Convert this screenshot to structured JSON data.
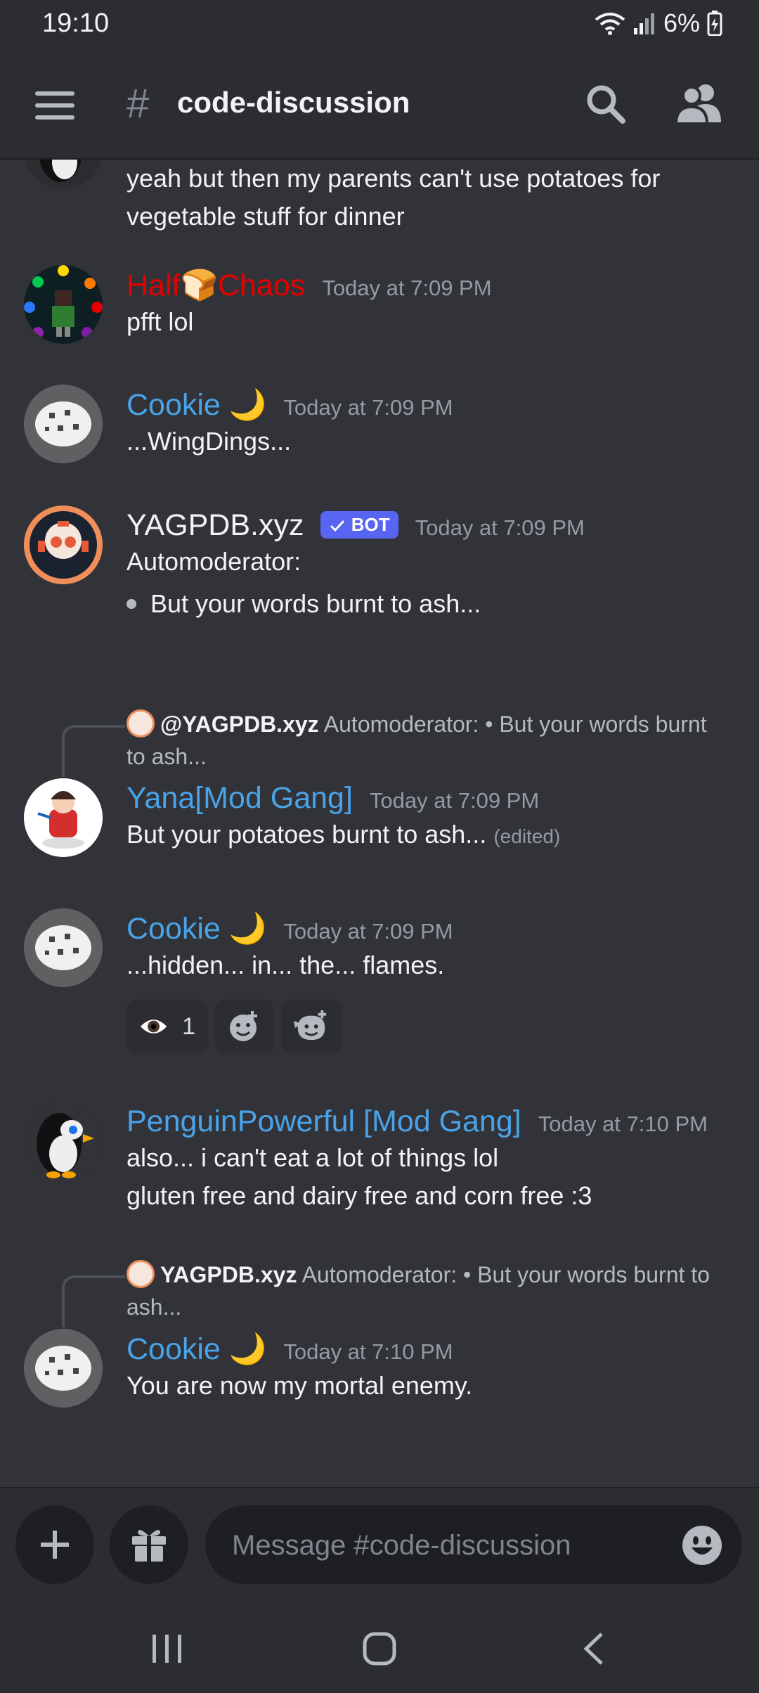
{
  "status_bar": {
    "time": "19:10",
    "battery": "6%"
  },
  "header": {
    "channel_name": "code-discussion"
  },
  "messages": {
    "partial": {
      "line1": "yeah but then my parents can't use potatoes for",
      "line2": "vegetable stuff for dinner"
    },
    "m1": {
      "username": "Half🍞Chaos",
      "timestamp": "Today at 7:09 PM",
      "text": "pfft lol",
      "name_color": "#e60000"
    },
    "m2": {
      "username": "Cookie 🌙",
      "timestamp": "Today at 7:09 PM",
      "text": "...WingDings..."
    },
    "m3": {
      "username": "YAGPDB.xyz",
      "bot_tag": "BOT",
      "timestamp": "Today at 7:09 PM",
      "text": "Automoderator:",
      "bullet": "But your words burnt to ash..."
    },
    "m4": {
      "reply_author": "@YAGPDB.xyz",
      "reply_text": " Automoderator: • But your words burnt to ash...",
      "username": "Yana[Mod Gang]",
      "timestamp": "Today at 7:09 PM",
      "text": "But your potatoes burnt to ash...",
      "edited": "(edited)"
    },
    "m5": {
      "username": "Cookie 🌙",
      "timestamp": "Today at 7:09 PM",
      "text": "...hidden... in... the... flames.",
      "reactions": [
        {
          "icon": "eye-icon",
          "count": "1"
        }
      ]
    },
    "m6": {
      "username": "PenguinPowerful [Mod Gang]",
      "timestamp": "Today at 7:10 PM",
      "line1": "also... i can't eat a lot of things lol",
      "line2": "gluten free and dairy free and corn free :3"
    },
    "m7": {
      "reply_author": "YAGPDB.xyz",
      "reply_text": " Automoderator: • But your words burnt to ash...",
      "username": "Cookie 🌙",
      "timestamp": "Today at 7:10 PM",
      "text": "You are now my mortal enemy."
    }
  },
  "composer": {
    "placeholder": "Message #code-discussion"
  },
  "colors": {
    "background": "#313338",
    "bar": "#2b2d31",
    "name_blue": "#4aa3e8",
    "name_red": "#e60000",
    "blurple": "#5865f2"
  }
}
